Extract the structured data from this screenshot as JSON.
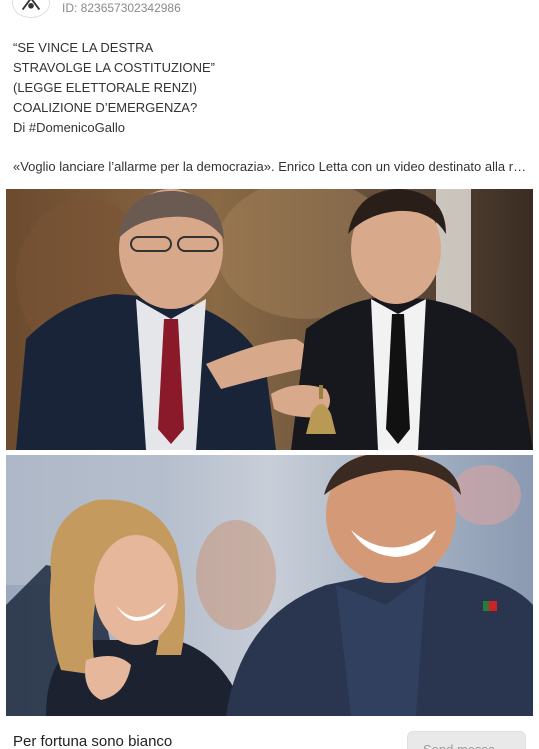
{
  "header": {
    "post_id": "ID: 823657302342986"
  },
  "post": {
    "lines": [
      "“SE VINCE LA DESTRA",
      "STRAVOLGE LA COSTITUZIONE”",
      "(LEGGE ELETTORALE RENZI)",
      "COALIZIONE D’EMERGENZA?",
      "Di #DomenicoGallo"
    ],
    "excerpt": "«Voglio lanciare l’allarme per la democrazia». Enrico Letta con un video destinato alla rete"
  },
  "images": {
    "top_photo": "photo-letta-renzi-bell",
    "bottom_photo": "photo-meloni-berlusconi"
  },
  "footer": {
    "name": "Per fortuna sono bianco",
    "send_label": "Send messa..."
  }
}
